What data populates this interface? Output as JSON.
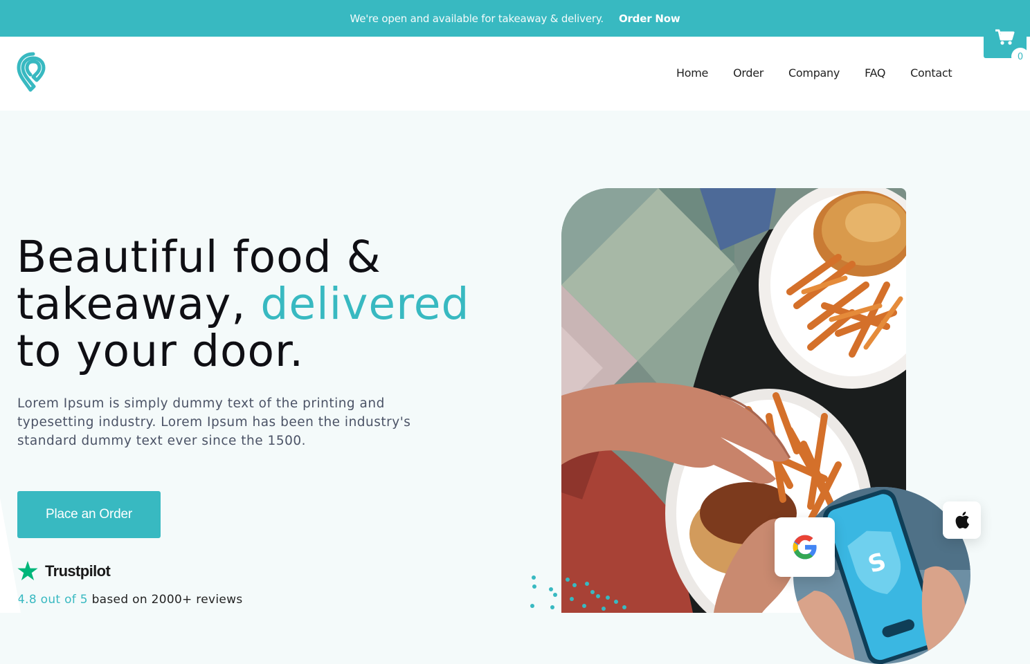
{
  "announcement": {
    "message": "We're open and available for takeaway & delivery.",
    "cta_label": "Order Now"
  },
  "header": {
    "logo_icon": "location-pin-logo-icon",
    "nav": [
      {
        "label": "Home"
      },
      {
        "label": "Order"
      },
      {
        "label": "Company"
      },
      {
        "label": "FAQ"
      },
      {
        "label": "Contact"
      }
    ],
    "cart": {
      "icon": "cart-icon",
      "count": "0"
    }
  },
  "hero": {
    "title_line1": "Beautiful food &",
    "title_line2_prefix": "takeaway, ",
    "title_line2_accent": "delivered",
    "title_line3": "to your door.",
    "description": "Lorem Ipsum is simply dummy text of the printing and typesetting industry. Lorem Ipsum has been the industry's standard dummy text ever since the 1500.",
    "button_label": "Place an Order",
    "trustpilot": {
      "brand": "Trustpilot",
      "rating_highlight": "4.8 out of 5",
      "rating_rest": " based on 2000+ reviews"
    },
    "badges": {
      "google_icon": "google-icon",
      "apple_icon": "apple-icon"
    }
  },
  "colors": {
    "accent": "#38b9c1",
    "background": "#f4fafa",
    "trustpilot_green": "#00b67a"
  }
}
